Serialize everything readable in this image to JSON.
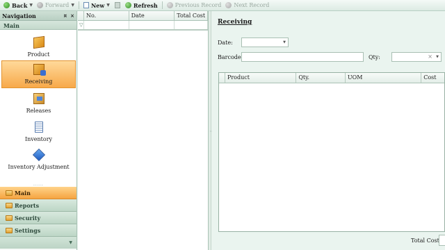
{
  "toolbar": {
    "back": "Back",
    "forward": "Forward",
    "new": "New",
    "refresh": "Refresh",
    "previous_record": "Previous Record",
    "next_record": "Next Record"
  },
  "navigation": {
    "title": "Navigation",
    "pin_glyph": "¤",
    "close_glyph": "×",
    "group_title": "Main",
    "items": [
      {
        "label": "Product",
        "icon": "product-box-icon"
      },
      {
        "label": "Receiving",
        "icon": "receiving-icon",
        "active": true
      },
      {
        "label": "Releases",
        "icon": "releases-icon"
      },
      {
        "label": "Inventory",
        "icon": "inventory-document-icon"
      },
      {
        "label": "Inventory Adjustment",
        "icon": "inventory-adjustment-cube-icon"
      }
    ],
    "groups": [
      {
        "label": "Main",
        "active": true
      },
      {
        "label": "Reports"
      },
      {
        "label": "Security"
      },
      {
        "label": "Settings"
      }
    ]
  },
  "list_grid": {
    "columns": [
      "No.",
      "Date",
      "Total Cost"
    ]
  },
  "detail": {
    "title": "Receiving",
    "date_label": "Date:",
    "date_value": "",
    "barcode_label": "Barcode:",
    "barcode_value": "",
    "qty_label": "Qty:",
    "qty_value": "",
    "columns": [
      "Product",
      "Qty.",
      "UOM",
      "Cost"
    ],
    "total_cost_label": "Total Cost:",
    "total_cost_value": ""
  },
  "colors": {
    "accent_active": "#f7a94a",
    "panel_bg": "#eaf4ef",
    "header_green": "#c4d9cc"
  }
}
